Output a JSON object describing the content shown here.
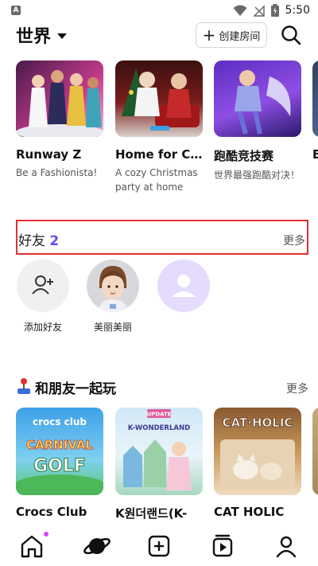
{
  "status_bar": {
    "time": "5:50",
    "left_badge": "A"
  },
  "header": {
    "title": "世界",
    "create_room_label": "创建房间"
  },
  "rooms": [
    {
      "title": "Runway Z",
      "desc": "Be a Fashionista!"
    },
    {
      "title": "Home for C…",
      "desc": "A cozy Christmas party at home"
    },
    {
      "title": "跑酷竞技赛",
      "desc": "世界最强跑酷对决！"
    },
    {
      "title": "B",
      "desc": ""
    }
  ],
  "friends": {
    "title": "好友",
    "count": "2",
    "more": "更多",
    "items": [
      {
        "label": "添加好友"
      },
      {
        "label": "美丽美丽"
      },
      {
        "label": ""
      }
    ]
  },
  "play_together": {
    "title": "和朋友一起玩",
    "more": "更多",
    "games": [
      {
        "title": "Crocs Club",
        "thumb_text_1": "crocs club",
        "thumb_text_2": "CARNIVAL",
        "thumb_text_3": "GOLF"
      },
      {
        "title": "K원더랜드(K-",
        "thumb_text_1": "UPDATE",
        "thumb_text_2": "K-WONDERLAND"
      },
      {
        "title": "CAT HOLIC",
        "thumb_text_1": "CAT·HOLIC"
      }
    ]
  },
  "nav": {
    "items": [
      "home-icon",
      "planet-icon",
      "add-icon",
      "play-icon",
      "profile-icon"
    ],
    "accent": "#e040fb"
  },
  "colors": {
    "accent_purple": "#6b4cf5",
    "highlight_red": "#e0312f",
    "avatar_placeholder": "#e5dcfd"
  }
}
